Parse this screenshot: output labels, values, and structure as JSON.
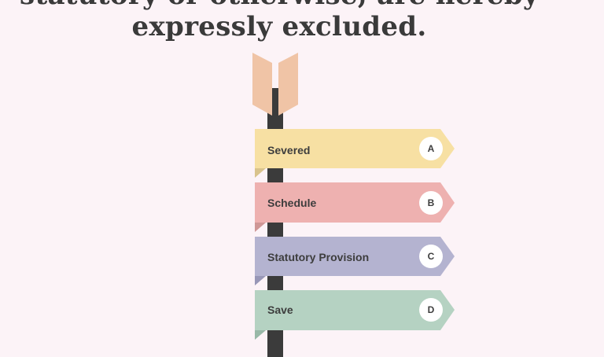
{
  "question": {
    "line_top": "statutory or otherwise, are hereby",
    "line_bottom": "expressly excluded."
  },
  "options": [
    {
      "letter": "A",
      "label": "Severed",
      "color": "#f7e0a3"
    },
    {
      "letter": "B",
      "label": "Schedule",
      "color": "#eeb1b0"
    },
    {
      "letter": "C",
      "label": "Statutory Provision",
      "color": "#b4b3d0"
    },
    {
      "letter": "D",
      "label": "Save",
      "color": "#b5d2c2"
    }
  ],
  "colors": {
    "background": "#fcf3f7",
    "post": "#3b3b3b",
    "fletching": "#f0c4a6"
  }
}
